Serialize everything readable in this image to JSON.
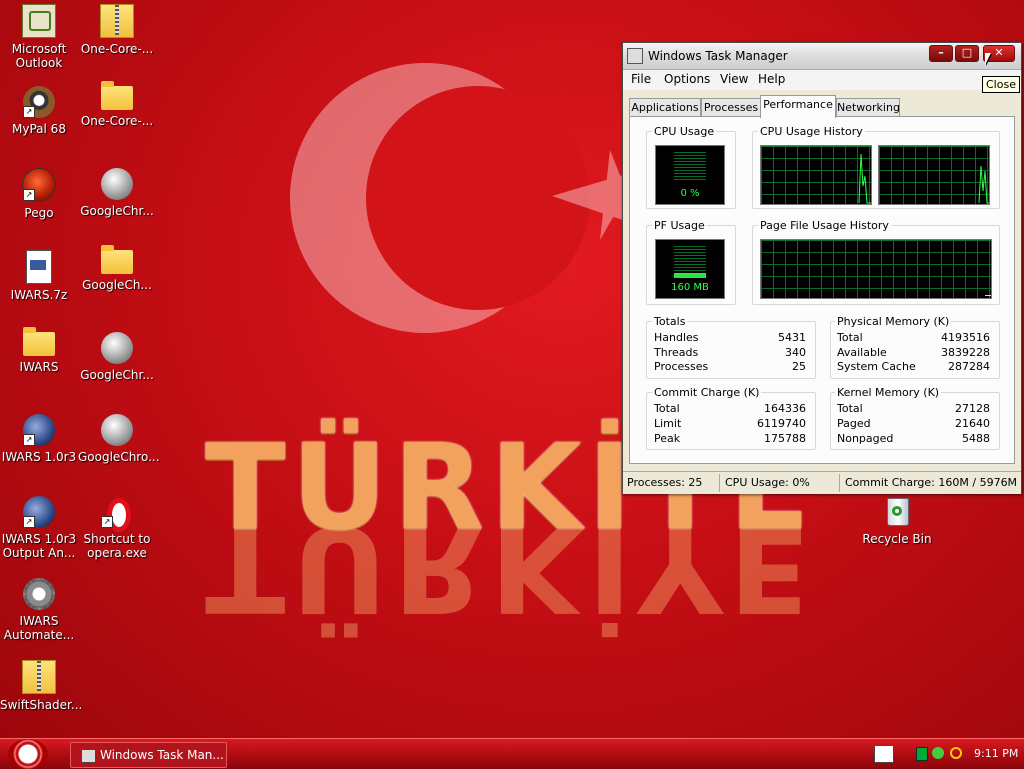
{
  "desktop": {
    "icons": [
      {
        "label": "Microsoft Outlook",
        "line1": "Microsoft",
        "line2": "Outlook",
        "icon": "outlook-icon"
      },
      {
        "label": "One-Core-...",
        "line1": "One-Core-...",
        "line2": "",
        "icon": "zip-folder-icon"
      },
      {
        "label": "MyPal 68",
        "line1": "MyPal 68",
        "line2": "",
        "icon": "mypal-icon"
      },
      {
        "label": "One-Core-...",
        "line1": "One-Core-...",
        "line2": "",
        "icon": "folder-icon"
      },
      {
        "label": "Pego",
        "line1": "Pego",
        "line2": "",
        "icon": "pego-icon"
      },
      {
        "label": "GoogleChr...",
        "line1": "GoogleChr...",
        "line2": "",
        "icon": "chrome-ball-icon"
      },
      {
        "label": "IWARS.7z",
        "line1": "IWARS.7z",
        "line2": "",
        "icon": "archive-file-icon"
      },
      {
        "label": "GoogleCh...",
        "line1": "GoogleCh...",
        "line2": "",
        "icon": "folder-icon"
      },
      {
        "label": "IWARS",
        "line1": "IWARS",
        "line2": "",
        "icon": "folder-icon"
      },
      {
        "label": "GoogleChr...",
        "line1": "GoogleChr...",
        "line2": "",
        "icon": "chrome-ball-icon"
      },
      {
        "label": "IWARS 1.0r3",
        "line1": "IWARS 1.0r3",
        "line2": "",
        "icon": "iwars-icon"
      },
      {
        "label": "GoogleChro...",
        "line1": "GoogleChro...",
        "line2": "",
        "icon": "chrome-ball-icon"
      },
      {
        "label": "IWARS 1.0r3 Output An...",
        "line1": "IWARS 1.0r3",
        "line2": "Output An...",
        "icon": "iwars-icon"
      },
      {
        "label": "Shortcut to opera.exe",
        "line1": "Shortcut to",
        "line2": "opera.exe",
        "icon": "opera-icon"
      },
      {
        "label": "IWARS Automate...",
        "line1": "IWARS",
        "line2": "Automate...",
        "icon": "gear-icon"
      },
      {
        "label": "SwiftShader...",
        "line1": "SwiftShader...",
        "line2": "",
        "icon": "zip-folder-icon"
      },
      {
        "label": "Recycle Bin",
        "line1": "Recycle Bin",
        "line2": "",
        "icon": "recycle-bin-icon"
      }
    ],
    "wallpaper_text": "TÜRKİYE"
  },
  "taskmgr": {
    "title": "Windows Task Manager",
    "buttons": {
      "minimize": "–",
      "maximize": "□",
      "close": "✕"
    },
    "menu": [
      "File",
      "Options",
      "View",
      "Help"
    ],
    "tabs": [
      "Applications",
      "Processes",
      "Performance",
      "Networking"
    ],
    "active_tab": "Performance",
    "cpu_usage": {
      "label": "CPU Usage",
      "value": "0 %"
    },
    "cpu_history": {
      "label": "CPU Usage History"
    },
    "pf_usage": {
      "label": "PF Usage",
      "value": "160 MB"
    },
    "pf_history": {
      "label": "Page File Usage History"
    },
    "totals": {
      "label": "Totals",
      "rows": [
        {
          "k": "Handles",
          "v": "5431"
        },
        {
          "k": "Threads",
          "v": "340"
        },
        {
          "k": "Processes",
          "v": "25"
        }
      ]
    },
    "physical": {
      "label": "Physical Memory (K)",
      "rows": [
        {
          "k": "Total",
          "v": "4193516"
        },
        {
          "k": "Available",
          "v": "3839228"
        },
        {
          "k": "System Cache",
          "v": "287284"
        }
      ]
    },
    "commit": {
      "label": "Commit Charge (K)",
      "rows": [
        {
          "k": "Total",
          "v": "164336"
        },
        {
          "k": "Limit",
          "v": "6119740"
        },
        {
          "k": "Peak",
          "v": "175788"
        }
      ]
    },
    "kernel": {
      "label": "Kernel Memory (K)",
      "rows": [
        {
          "k": "Total",
          "v": "27128"
        },
        {
          "k": "Paged",
          "v": "21640"
        },
        {
          "k": "Nonpaged",
          "v": "5488"
        }
      ]
    },
    "status": {
      "processes": "Processes: 25",
      "cpu": "CPU Usage: 0%",
      "commit": "Commit Charge: 160M / 5976M"
    }
  },
  "tooltip": "Close",
  "taskbar": {
    "item": "Windows Task Man...",
    "clock": "9:11 PM"
  },
  "colors": {
    "graph_green": "#2eff4a",
    "grid_green": "#0a6b2a",
    "taskbar_red": "#b3131a"
  }
}
